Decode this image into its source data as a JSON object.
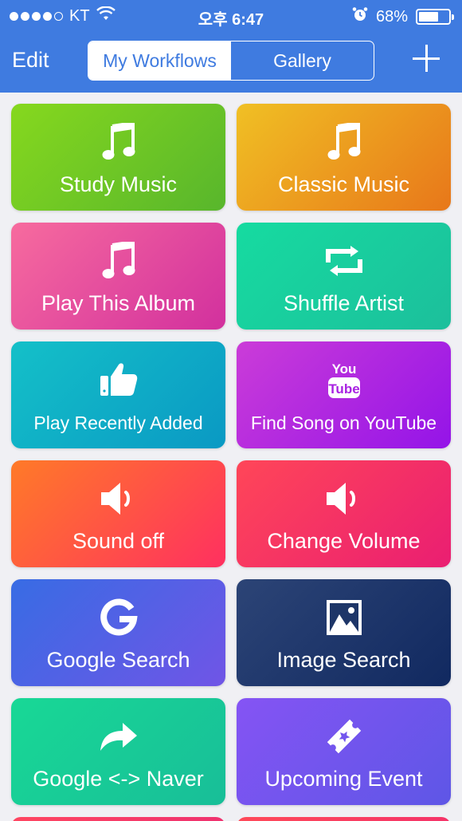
{
  "status": {
    "carrier": "KT",
    "time": "오후 6:47",
    "battery": "68%",
    "battery_level": 0.68
  },
  "nav": {
    "edit_label": "Edit",
    "tabs": [
      {
        "label": "My Workflows",
        "active": true
      },
      {
        "label": "Gallery",
        "active": false
      }
    ],
    "add_icon": "plus-icon"
  },
  "workflows": [
    {
      "label": "Study Music",
      "icon": "music-note-icon",
      "colors": [
        "#86d81e",
        "#58b62c"
      ]
    },
    {
      "label": "Classic Music",
      "icon": "music-note-icon",
      "colors": [
        "#f0c024",
        "#e8771a"
      ]
    },
    {
      "label": "Play This Album",
      "icon": "music-note-icon",
      "colors": [
        "#f76b9e",
        "#d2309e"
      ]
    },
    {
      "label": "Shuffle Artist",
      "icon": "repeat-icon",
      "colors": [
        "#16dba0",
        "#1cbf9c"
      ]
    },
    {
      "label": "Play Recently Added",
      "icon": "thumbs-up-icon",
      "colors": [
        "#14c0c8",
        "#0a99c4"
      ]
    },
    {
      "label": "Find Song on YouTube",
      "icon": "youtube-icon",
      "colors": [
        "#cb3cd8",
        "#9414e8"
      ]
    },
    {
      "label": "Sound off",
      "icon": "speaker-icon",
      "colors": [
        "#ff7a28",
        "#ff3060"
      ]
    },
    {
      "label": "Change Volume",
      "icon": "speaker-icon",
      "colors": [
        "#ff4658",
        "#ea1e72"
      ]
    },
    {
      "label": "Google Search",
      "icon": "google-icon",
      "colors": [
        "#386ce4",
        "#7055e6"
      ]
    },
    {
      "label": "Image Search",
      "icon": "image-icon",
      "colors": [
        "#2c4476",
        "#112960"
      ]
    },
    {
      "label": "Google <-> Naver",
      "icon": "share-arrow-icon",
      "colors": [
        "#18d896",
        "#18be98"
      ]
    },
    {
      "label": "Upcoming Event",
      "icon": "ticket-icon",
      "colors": [
        "#8554f4",
        "#5e56e6"
      ]
    }
  ],
  "partial_tiles": [
    {
      "colors": [
        "#ff4660",
        "#ee3070"
      ]
    },
    {
      "colors": [
        "#ff4a58",
        "#f4326a"
      ]
    }
  ]
}
